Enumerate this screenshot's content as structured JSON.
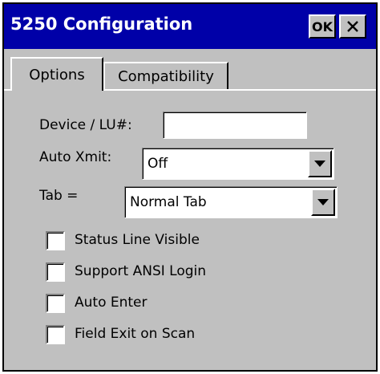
{
  "window": {
    "title": "5250 Configuration",
    "ok_label": "OK",
    "close_icon": "close-icon"
  },
  "tabs": [
    {
      "label": "Options",
      "selected": true
    },
    {
      "label": "Compatibility",
      "selected": false
    }
  ],
  "form": {
    "device_label": "Device / LU#:",
    "device_value": "",
    "auto_xmit_label": "Auto Xmit:",
    "auto_xmit_value": "Off",
    "tab_label": "Tab =",
    "tab_value": "Normal Tab"
  },
  "checkboxes": [
    {
      "label": "Status Line Visible",
      "checked": false
    },
    {
      "label": "Support ANSI Login",
      "checked": false
    },
    {
      "label": "Auto Enter",
      "checked": false
    },
    {
      "label": "Field Exit on Scan",
      "checked": false
    }
  ],
  "colors": {
    "titlebar": "#0000a8",
    "face": "#c0c0c0"
  }
}
